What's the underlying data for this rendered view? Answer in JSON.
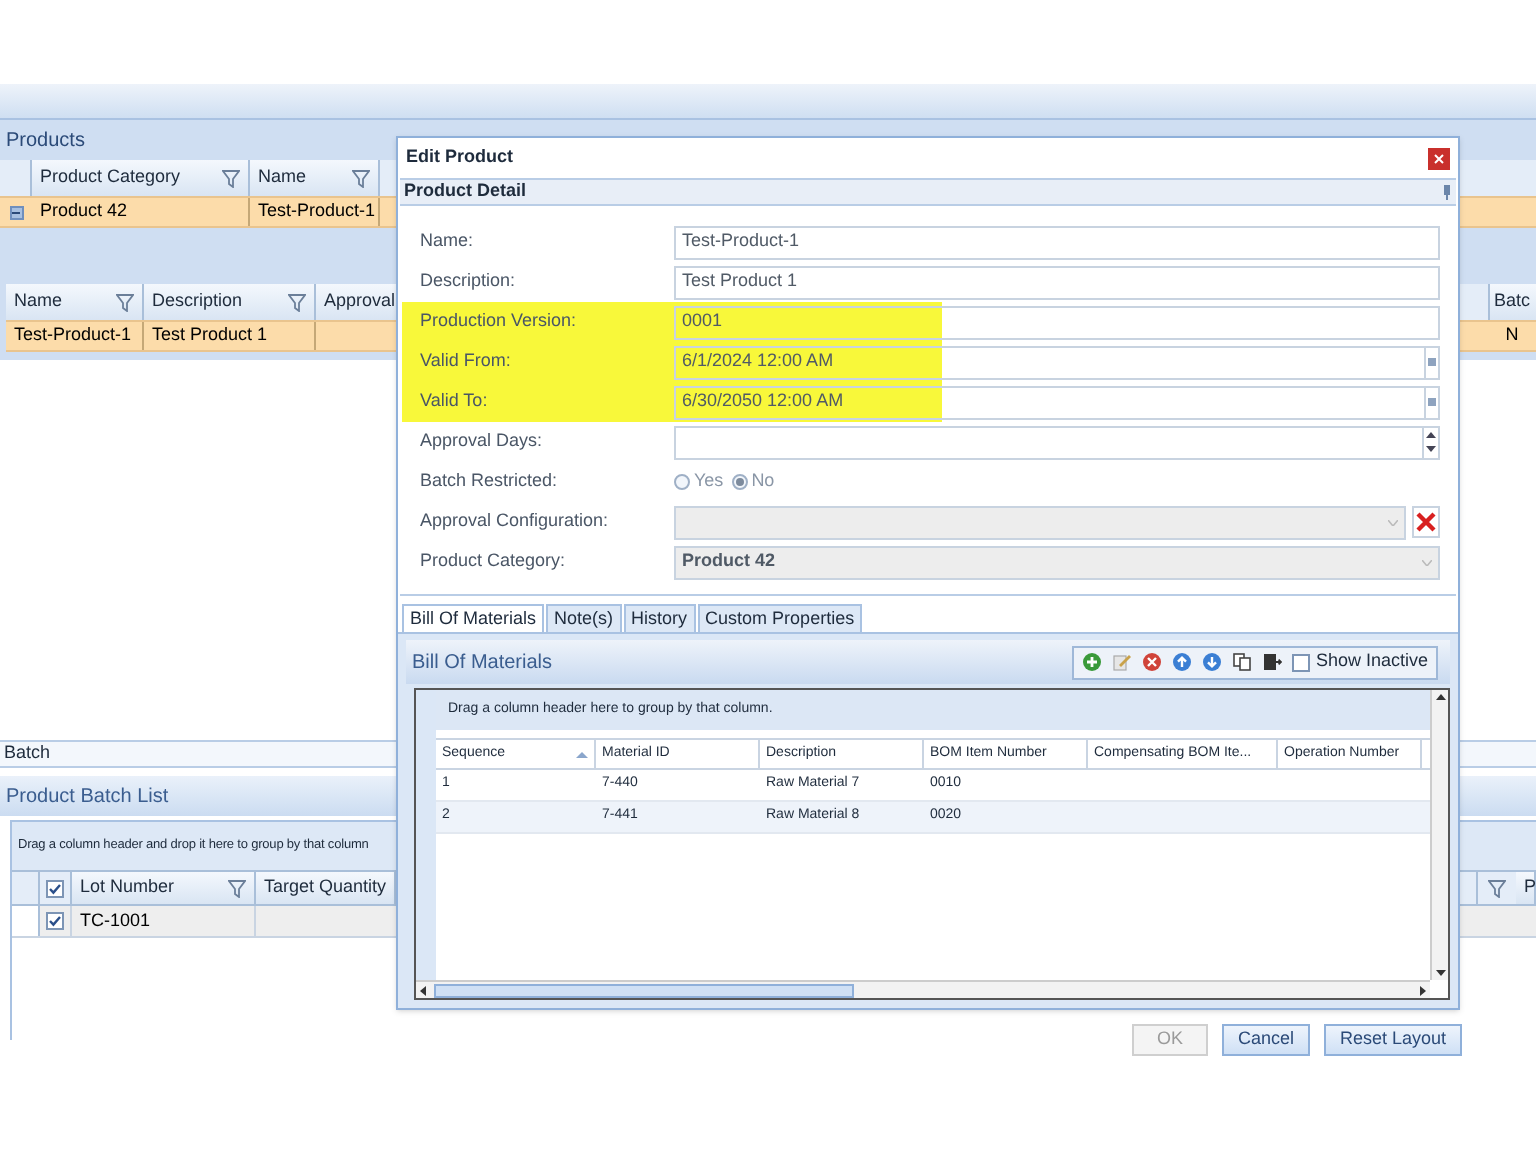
{
  "products_panel": {
    "title": "Products",
    "category_grid": {
      "columns": [
        "Product Category",
        "Name"
      ],
      "rows": [
        {
          "expanded": true,
          "cells": [
            "Product 42",
            "Test-Product-1"
          ]
        }
      ]
    },
    "product_grid": {
      "columns": [
        "Name",
        "Description",
        "Approval"
      ],
      "right_column": "Batc",
      "rows": [
        {
          "cells": [
            "Test-Product-1",
            "Test Product 1"
          ],
          "right_cell": "N"
        }
      ]
    }
  },
  "batch_panel": {
    "tab": "Batch",
    "title": "Product Batch List",
    "group_hint": "Drag a column header and drop it here to group by that column",
    "all_checked": true,
    "columns": [
      "Lot Number",
      "Target Quantity"
    ],
    "right_column": "P",
    "rows": [
      {
        "checked": true,
        "cells": [
          "TC-1001"
        ]
      }
    ]
  },
  "dialog": {
    "title": "Edit Product",
    "section": "Product Detail",
    "fields": [
      {
        "label": "Name:",
        "kind": "text",
        "value": "Test-Product-1",
        "highlighted": false
      },
      {
        "label": "Description:",
        "kind": "text",
        "value": "Test Product 1",
        "highlighted": false
      },
      {
        "label": "Production Version:",
        "kind": "text",
        "value": "0001",
        "highlighted": true
      },
      {
        "label": "Valid From:",
        "kind": "date",
        "value": "6/1/2024 12:00 AM",
        "highlighted": true
      },
      {
        "label": "Valid To:",
        "kind": "date",
        "value": "6/30/2050 12:00 AM",
        "highlighted": true
      },
      {
        "label": "Approval Days:",
        "kind": "spin",
        "highlighted": false
      },
      {
        "label": "Batch Restricted:",
        "kind": "radio",
        "highlighted": false,
        "options": [
          {
            "label": "Yes",
            "selected": false
          },
          {
            "label": "No",
            "selected": true
          }
        ]
      },
      {
        "label": "Approval Configuration:",
        "kind": "combo_clear",
        "disabled": true,
        "highlighted": false
      },
      {
        "label": "Product Category:",
        "kind": "combo",
        "disabled": true,
        "value": "Product 42",
        "highlighted": false
      }
    ],
    "tabs": [
      {
        "label": "Bill Of Materials",
        "selected": true
      },
      {
        "label": "Note(s)",
        "selected": false
      },
      {
        "label": "History",
        "selected": false
      },
      {
        "label": "Custom Properties",
        "selected": false
      }
    ],
    "bom": {
      "title": "Bill Of Materials",
      "show_inactive_label": "Show Inactive",
      "show_inactive": false,
      "group_hint": "Drag a column header here to group by that column.",
      "columns": [
        "Sequence",
        "Material ID",
        "Description",
        "BOM Item Number",
        "Compensating BOM Ite...",
        "Operation Number"
      ],
      "rows": [
        [
          "1",
          "7-440",
          "Raw Material 7",
          "0010"
        ],
        [
          "2",
          "7-441",
          "Raw Material 8",
          "0020"
        ]
      ]
    },
    "buttons": [
      {
        "label": "OK",
        "disabled": true
      },
      {
        "label": "Cancel",
        "disabled": false
      },
      {
        "label": "Reset Layout",
        "disabled": false
      }
    ]
  }
}
